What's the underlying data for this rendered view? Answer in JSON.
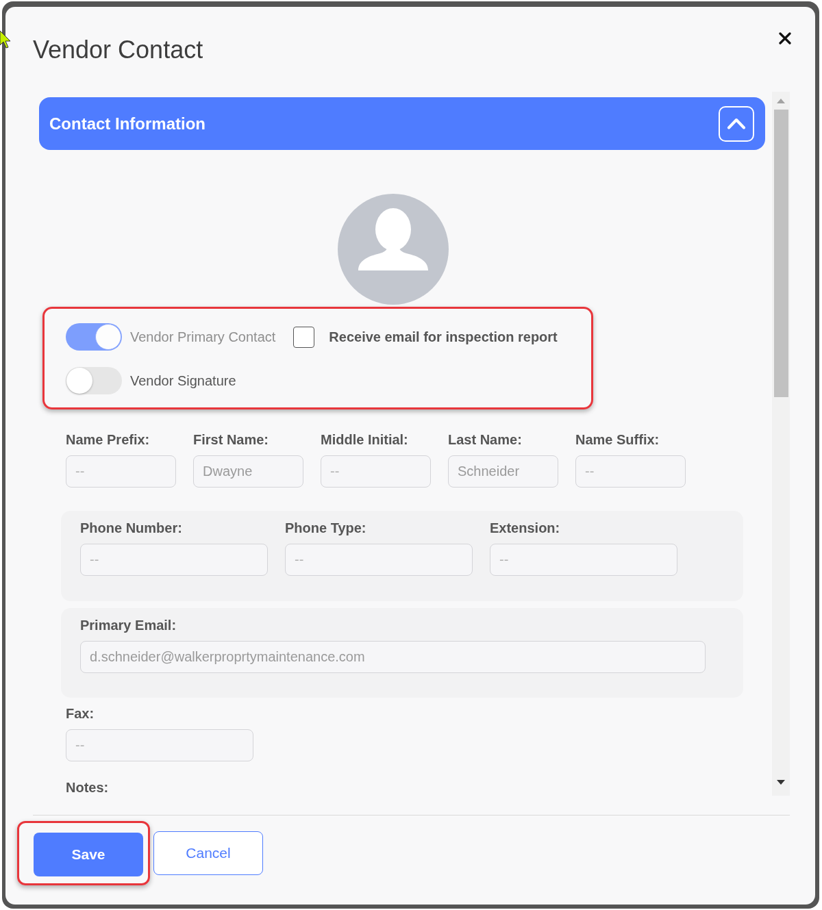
{
  "dialog": {
    "title": "Vendor Contact"
  },
  "section": {
    "title": "Contact Information",
    "expanded": true
  },
  "options": {
    "highlighted": true,
    "toggles": [
      {
        "label": "Vendor Primary Contact",
        "on": true,
        "disabled": true
      },
      {
        "label": "Vendor Signature",
        "on": false,
        "disabled": false
      }
    ],
    "checkbox": {
      "label": "Receive email for inspection report",
      "checked": false
    }
  },
  "name_fields": [
    {
      "label": "Name Prefix:",
      "placeholder": "--"
    },
    {
      "label": "First Name:",
      "value": "Dwayne"
    },
    {
      "label": "Middle Initial:",
      "placeholder": "--"
    },
    {
      "label": "Last Name:",
      "value": "Schneider"
    },
    {
      "label": "Name Suffix:",
      "placeholder": "--"
    }
  ],
  "phone_fields": [
    {
      "label": "Phone Number:",
      "placeholder": "--"
    },
    {
      "label": "Phone Type:",
      "placeholder": "--"
    },
    {
      "label": "Extension:",
      "placeholder": "--"
    }
  ],
  "email_fields": [
    {
      "label": "Primary Email:",
      "value": "d.schneider@walkerproprtymaintenance.com"
    }
  ],
  "fax": {
    "label": "Fax:",
    "placeholder": "--"
  },
  "notes": {
    "label": "Notes:"
  },
  "buttons": [
    {
      "label": "Save",
      "kind": "primary",
      "highlighted": true
    },
    {
      "label": "Cancel",
      "kind": "secondary",
      "highlighted": false
    }
  ]
}
